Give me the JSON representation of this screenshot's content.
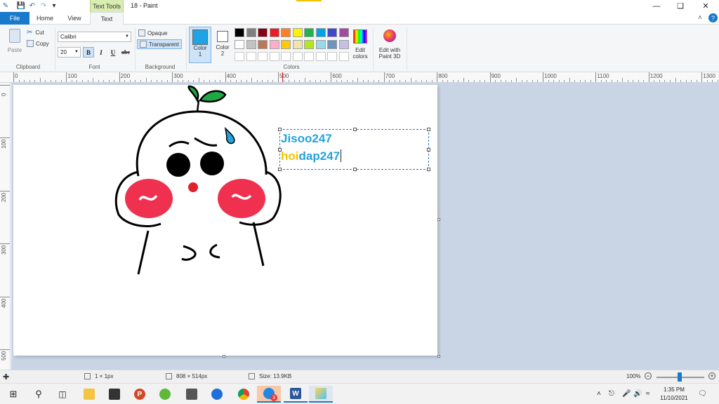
{
  "window": {
    "title": "18 - Paint",
    "contextual_tab": "Text Tools"
  },
  "tabs": {
    "file": "File",
    "home": "Home",
    "view": "View",
    "text": "Text"
  },
  "clipboard": {
    "paste": "Paste",
    "cut": "Cut",
    "copy": "Copy",
    "label": "Clipboard"
  },
  "font": {
    "family": "Calibri",
    "size": "20",
    "bold": "B",
    "italic": "I",
    "underline": "U",
    "strike": "abc",
    "label": "Font"
  },
  "background": {
    "opaque": "Opaque",
    "transparent": "Transparent",
    "label": "Background"
  },
  "colors": {
    "color1_line1": "Color",
    "color1_line2": "1",
    "color2_line1": "Color",
    "color2_line2": "2",
    "label": "Colors",
    "edit_line1": "Edit",
    "edit_line2": "colors",
    "paint3d_line1": "Edit with",
    "paint3d_line2": "Paint 3D",
    "color1_value": "#1ea3e4",
    "color2_value": "#ffffff",
    "palette_row1": [
      "#000000",
      "#7f7f7f",
      "#880015",
      "#ed1c24",
      "#ff7f27",
      "#fff200",
      "#22b14c",
      "#00a2e8",
      "#3f48cc",
      "#a349a4"
    ],
    "palette_row2": [
      "#ffffff",
      "#c3c3c3",
      "#b97a57",
      "#ffaec9",
      "#ffc90e",
      "#efe4b0",
      "#b5e61d",
      "#99d9ea",
      "#7092be",
      "#c8bfe7"
    ]
  },
  "ruler": {
    "top": [
      "0",
      "100",
      "200",
      "300",
      "400",
      "500",
      "600",
      "700",
      "800",
      "900",
      "1000",
      "1100",
      "1200",
      "1300"
    ],
    "left": [
      "0",
      "100",
      "200",
      "300",
      "400",
      "500"
    ]
  },
  "canvas_text": {
    "line1": "Jisoo247",
    "line2_part1": "hoi",
    "line2_part2": "dap247"
  },
  "status": {
    "cursor": "1 × 1px",
    "dimensions": "808 × 514px",
    "size": "Size: 13.9KB",
    "zoom": "100%"
  },
  "taskbar": {
    "time": "1:35 PM",
    "date": "11/10/2021",
    "badge": "3"
  }
}
